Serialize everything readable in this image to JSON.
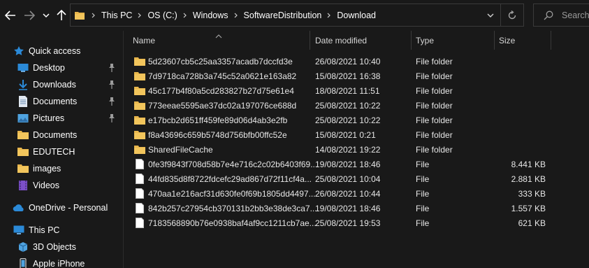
{
  "address": {
    "crumbs": [
      "This PC",
      "OS (C:)",
      "Windows",
      "SoftwareDistribution",
      "Download"
    ]
  },
  "search": {
    "placeholder": "Search"
  },
  "sidebar": {
    "quick_access": "Quick access",
    "items": [
      {
        "label": "Desktop",
        "pinned": true
      },
      {
        "label": "Downloads",
        "pinned": true
      },
      {
        "label": "Documents",
        "pinned": true
      },
      {
        "label": "Pictures",
        "pinned": true
      },
      {
        "label": "Documents",
        "pinned": false
      },
      {
        "label": "EDUTECH",
        "pinned": false
      },
      {
        "label": "images",
        "pinned": false
      },
      {
        "label": "Videos",
        "pinned": false
      }
    ],
    "onedrive": "OneDrive - Personal",
    "this_pc": "This PC",
    "pc_items": [
      "3D Objects",
      "Apple iPhone"
    ]
  },
  "columns": {
    "name": "Name",
    "date": "Date modified",
    "type": "Type",
    "size": "Size"
  },
  "files": [
    {
      "name": "5d23607cb5c25aa3357acadb7dccfd3e",
      "date": "26/08/2021 10:40",
      "type": "File folder",
      "size": "",
      "kind": "folder"
    },
    {
      "name": "7d9718ca728b3a745c52a0621e163a82",
      "date": "15/08/2021 16:38",
      "type": "File folder",
      "size": "",
      "kind": "folder"
    },
    {
      "name": "45c177b4f80a5cd283827b27d75e61e4",
      "date": "18/08/2021 11:51",
      "type": "File folder",
      "size": "",
      "kind": "folder"
    },
    {
      "name": "773eeae5595ae37dc02a197076ce688d",
      "date": "25/08/2021 10:22",
      "type": "File folder",
      "size": "",
      "kind": "folder"
    },
    {
      "name": "e17bcb2d651ff459fe89d06d4ab3e2fb",
      "date": "25/08/2021 10:22",
      "type": "File folder",
      "size": "",
      "kind": "folder"
    },
    {
      "name": "f8a43696c659b5748d756bfb00ffc52e",
      "date": "15/08/2021 0:21",
      "type": "File folder",
      "size": "",
      "kind": "folder"
    },
    {
      "name": "SharedFileCache",
      "date": "14/08/2021 19:22",
      "type": "File folder",
      "size": "",
      "kind": "folder"
    },
    {
      "name": "0fe3f9843f708d58b7e4e716c2c02b6403f69...",
      "date": "19/08/2021 18:46",
      "type": "File",
      "size": "8.441 KB",
      "kind": "file"
    },
    {
      "name": "44fd835d8f8722fdcefc29ad867d72f11cf4a...",
      "date": "25/08/2021 10:04",
      "type": "File",
      "size": "2.881 KB",
      "kind": "file"
    },
    {
      "name": "470aa1e216acf31d630fe0f69b1805dd4497...",
      "date": "26/08/2021 10:44",
      "type": "File",
      "size": "333 KB",
      "kind": "file"
    },
    {
      "name": "842b257c27954cb370131b2bb3e38de3ca7...",
      "date": "19/08/2021 18:46",
      "type": "File",
      "size": "1.557 KB",
      "kind": "file"
    },
    {
      "name": "7183568890b76e0938baf4af9cc1211cb7ae...",
      "date": "25/08/2021 19:53",
      "type": "File",
      "size": "621 KB",
      "kind": "file"
    }
  ],
  "colors": {
    "folder": "#e8b64c",
    "accent": "#2b8ad8",
    "pin": "#9c9c9c"
  }
}
